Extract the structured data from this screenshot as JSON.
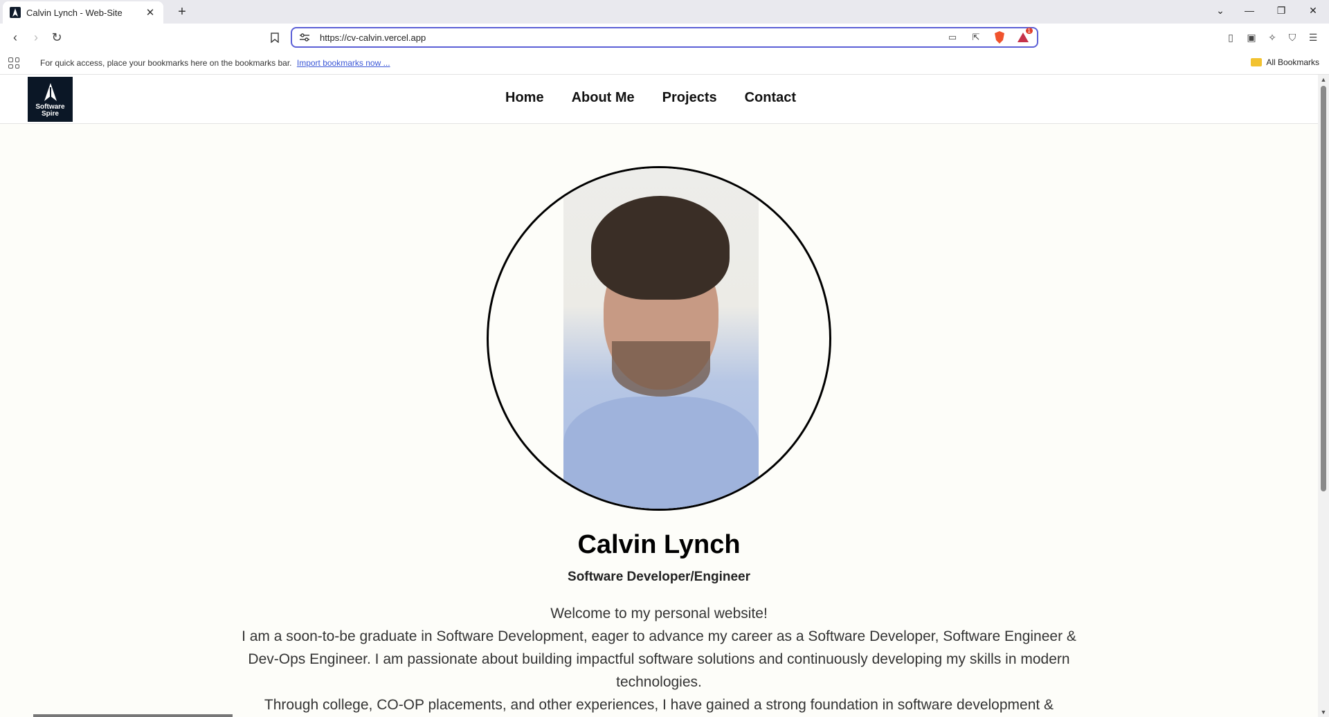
{
  "browser": {
    "tab_title": "Calvin Lynch - Web-Site",
    "url": "https://cv-calvin.vercel.app",
    "bookmarks_bar_text": "For quick access, place your bookmarks here on the bookmarks bar.",
    "bookmarks_import_link": "Import bookmarks now ...",
    "all_bookmarks_label": "All Bookmarks",
    "brave_notification_count": "1"
  },
  "site": {
    "logo_line1": "Software",
    "logo_line2": "Spire",
    "nav": [
      {
        "label": "Home"
      },
      {
        "label": "About Me"
      },
      {
        "label": "Projects"
      },
      {
        "label": "Contact"
      }
    ]
  },
  "hero": {
    "name": "Calvin Lynch",
    "role": "Software Developer/Engineer",
    "bio_lines": [
      "Welcome to my personal website!",
      "I am a soon-to-be graduate in Software Development, eager to advance my career as a Software Developer, Software Engineer & Dev-Ops Engineer. I am passionate about building impactful software solutions and continuously developing my skills in modern technologies.",
      "Through college, CO-OP placements, and other experiences, I have gained a strong foundation in software development &"
    ]
  },
  "colors": {
    "url_focus_border": "#5b5fd6",
    "logo_bg": "#0b1726",
    "page_bg": "#fdfdf9",
    "link": "#3a56d6"
  }
}
